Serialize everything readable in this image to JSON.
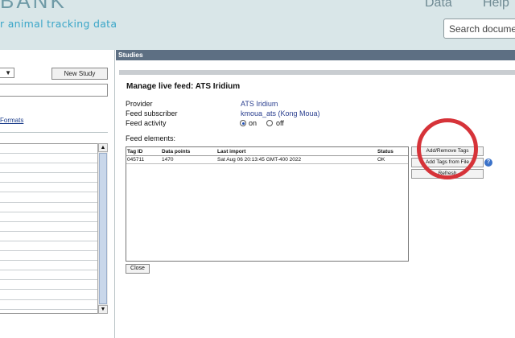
{
  "header": {
    "logo_fragment": "BANK",
    "tagline": "r animal tracking data",
    "nav": {
      "data": "Data",
      "help": "Help"
    },
    "search": {
      "placeholder": "Search docume"
    }
  },
  "sidebar": {
    "new_study_label": "New Study",
    "formats_link": "Formats"
  },
  "studies": {
    "header": "Studies"
  },
  "manage": {
    "title": "Manage live feed: ATS Iridium",
    "provider_label": "Provider",
    "provider_value": "ATS Iridium",
    "subscriber_label": "Feed subscriber",
    "subscriber_value": "kmoua_ats (Kong Moua)",
    "activity_label": "Feed activity",
    "activity_on": "on",
    "activity_off": "off",
    "elements_label": "Feed elements:",
    "table": {
      "columns": [
        "Tag ID",
        "Data points",
        "Last import",
        "Status"
      ],
      "rows": [
        {
          "tag_id": "045711",
          "data_points": "1470",
          "last_import": "Sat Aug 06 20:13:45 GMT-400 2022",
          "status": "OK"
        }
      ]
    },
    "buttons": {
      "add_remove_tags": "Add/Remove Tags",
      "add_tags_from_file": "Add Tags from File",
      "refresh": "Refresh",
      "close": "Close"
    },
    "help_icon": "?"
  },
  "colors": {
    "header_bg": "#d9e6e8",
    "studies_bar": "#5d6f83",
    "link": "#2a3f8f",
    "annotation": "#d63339"
  }
}
